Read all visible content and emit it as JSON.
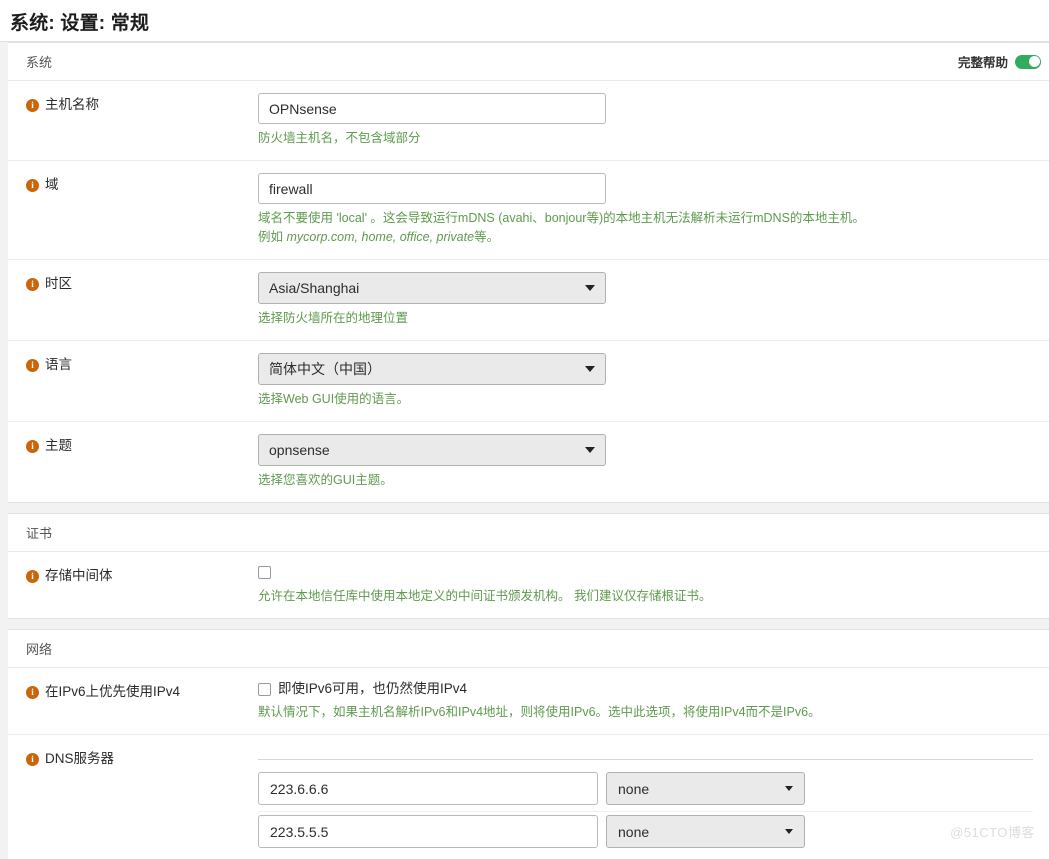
{
  "page": {
    "title": "系统: 设置: 常规",
    "watermark": "@51CTO博客"
  },
  "help_toggle": {
    "label": "完整帮助",
    "state": "on",
    "color": "#31ab5c"
  },
  "icons": {
    "info": "i",
    "info_color": "#c9660a"
  },
  "sections": {
    "system": {
      "heading": "系统",
      "hostname": {
        "label": "主机名称",
        "value": "OPNsense",
        "placeholder": "OPNsense",
        "help": "防火墙主机名，不包含域部分"
      },
      "domain": {
        "label": "域",
        "value": "firewall",
        "placeholder": "firewall",
        "help_line1": "域名不要使用 'local' 。这会导致运行mDNS (avahi、bonjour等)的本地主机无法解析未运行mDNS的本地主机。",
        "help_line2_prefix": "例如 ",
        "help_line2_italic": "mycorp.com, home, office, private",
        "help_line2_suffix": "等。"
      },
      "timezone": {
        "label": "时区",
        "value": "Asia/Shanghai",
        "help": "选择防火墙所在的地理位置"
      },
      "language": {
        "label": "语言",
        "value": "简体中文（中国）",
        "help": "选择Web GUI使用的语言。"
      },
      "theme": {
        "label": "主题",
        "value": "opnsense",
        "help": "选择您喜欢的GUI主题。"
      }
    },
    "certificate": {
      "heading": "证书",
      "store_intermediate": {
        "label": "存储中间体",
        "checked": false,
        "help": "允许在本地信任库中使用本地定义的中间证书颁发机构。 我们建议仅存储根证书。"
      }
    },
    "network": {
      "heading": "网络",
      "prefer_ipv4": {
        "label": "在IPv6上优先使用IPv4",
        "checkbox_label": "即使IPv6可用，也仍然使用IPv4",
        "checked": false,
        "help": "默认情况下，如果主机名解析IPv6和IPv4地址，则将使用IPv6。选中此选项，将使用IPv4而不是IPv6。"
      },
      "dns_servers": {
        "label": "DNS服务器",
        "rows": [
          {
            "ip": "223.6.6.6",
            "interface": "none"
          },
          {
            "ip": "223.5.5.5",
            "interface": "none"
          }
        ]
      }
    }
  }
}
